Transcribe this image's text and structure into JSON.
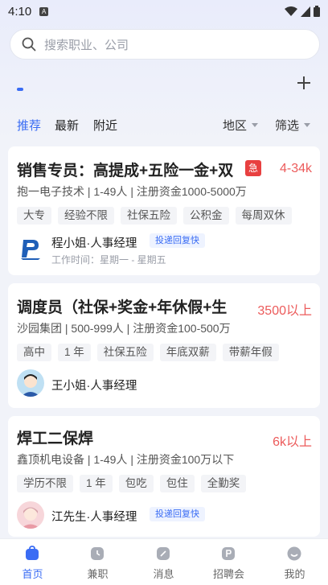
{
  "status_bar": {
    "time": "4:10",
    "sim_label": "A"
  },
  "search": {
    "placeholder": "搜索职业、公司"
  },
  "tabs": [
    {
      "label": "推荐",
      "active": true
    },
    {
      "label": "最新",
      "active": false
    },
    {
      "label": "附近",
      "active": false
    }
  ],
  "filters": {
    "region": "地区",
    "screen": "筛选"
  },
  "jobs": [
    {
      "title": "销售专员：高提成+五险一金+双",
      "urgent_label": "急",
      "salary": "4-34k",
      "company": "抱一电子技术 | 1-49人 | 注册资金1000-5000万",
      "tags": [
        "大专",
        "经验不限",
        "社保五险",
        "公积金",
        "每周双休"
      ],
      "recruiter": "程小姐·人事经理",
      "reply_badge": "投递回复快",
      "work_time": "工作时间：星期一 - 星期五"
    },
    {
      "title": "调度员（社保+奖金+年休假+生",
      "salary": "3500以上",
      "company": "沙园集团 | 500-999人 | 注册资金100-500万",
      "tags": [
        "高中",
        "1 年",
        "社保五险",
        "年底双薪",
        "带薪年假"
      ],
      "recruiter": "王小姐·人事经理"
    },
    {
      "title": "焊工二保焊",
      "salary": "6k以上",
      "company": "鑫顶机电设备 | 1-49人 | 注册资金100万以下",
      "tags": [
        "学历不限",
        "1 年",
        "包吃",
        "包住",
        "全勤奖"
      ],
      "recruiter": "江先生·人事经理",
      "reply_badge": "投递回复快"
    }
  ],
  "bottom_nav": [
    {
      "label": "首页",
      "icon": "home-icon",
      "active": true
    },
    {
      "label": "兼职",
      "icon": "clock-icon",
      "active": false
    },
    {
      "label": "消息",
      "icon": "message-icon",
      "active": false
    },
    {
      "label": "招聘会",
      "icon": "job-fair-icon",
      "active": false
    },
    {
      "label": "我的",
      "icon": "profile-icon",
      "active": false
    }
  ],
  "colors": {
    "accent": "#3a6cf4",
    "salary": "#ec5b5b",
    "urgent": "#e84040"
  }
}
